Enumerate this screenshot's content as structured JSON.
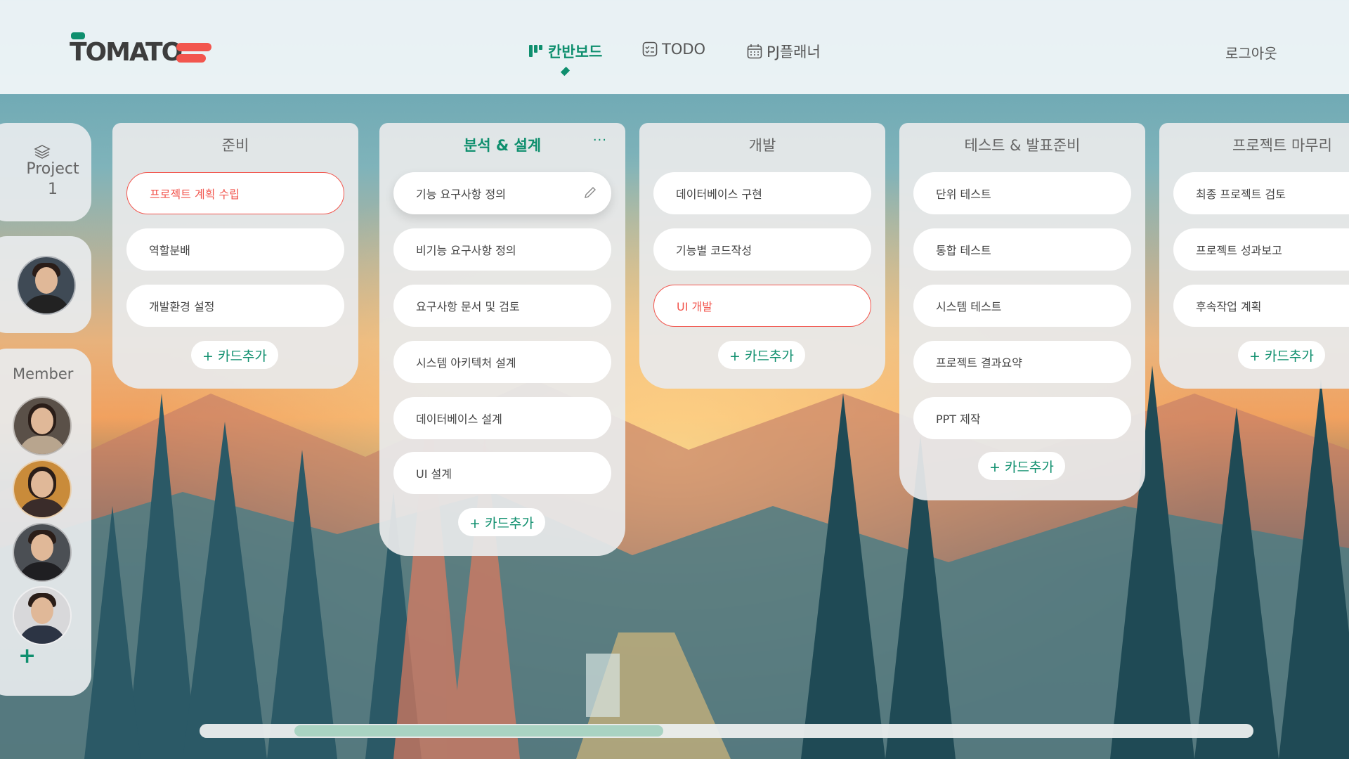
{
  "app": {
    "logo_text": "TOMATO",
    "accent_color": "#0f8f6e",
    "highlight_color": "#f2564e"
  },
  "nav": {
    "kanban": {
      "label": "칸반보드",
      "icon": "kanban-icon",
      "active": true
    },
    "todo": {
      "label": "TODO",
      "icon": "checklist-icon"
    },
    "planner": {
      "label": "PJ플래너",
      "icon": "calendar-icon"
    },
    "logout": "로그아웃"
  },
  "sidebar": {
    "project_label": "Project",
    "project_number": "1",
    "member_label": "Member",
    "add_member": "+"
  },
  "columns": [
    {
      "title": "준비",
      "cards": [
        "프로젝트 계획 수립",
        "역할분배",
        "개발환경 설정"
      ],
      "selected_index": 0,
      "add_label": "+ 카드추가"
    },
    {
      "title": "분석 & 설계",
      "menu": "···",
      "cards": [
        "기능 요구사항 정의",
        "비기능 요구사항 정의",
        "요구사항 문서 및 검토",
        "시스템 아키텍처 설계",
        "데이터베이스 설계",
        "UI 설계"
      ],
      "add_label": "+ 카드추가"
    },
    {
      "title": "개발",
      "cards": [
        "데이터베이스 구현",
        "기능별 코드작성",
        "UI 개발"
      ],
      "selected_index": 2,
      "add_label": "+ 카드추가"
    },
    {
      "title": "테스트 & 발표준비",
      "cards": [
        "단위 테스트",
        "통합 테스트",
        "시스템 테스트",
        "프로젝트 결과요약",
        "PPT 제작"
      ],
      "add_label": "+ 카드추가"
    },
    {
      "title": "프로젝트 마무리",
      "cards": [
        "최종 프로젝트 검토",
        "프로젝트 성과보고",
        "후속작업 계획"
      ],
      "add_label": "+ 카드추가"
    }
  ],
  "scrollbar": {
    "position_fraction": 0.09,
    "visible_fraction": 0.35
  }
}
